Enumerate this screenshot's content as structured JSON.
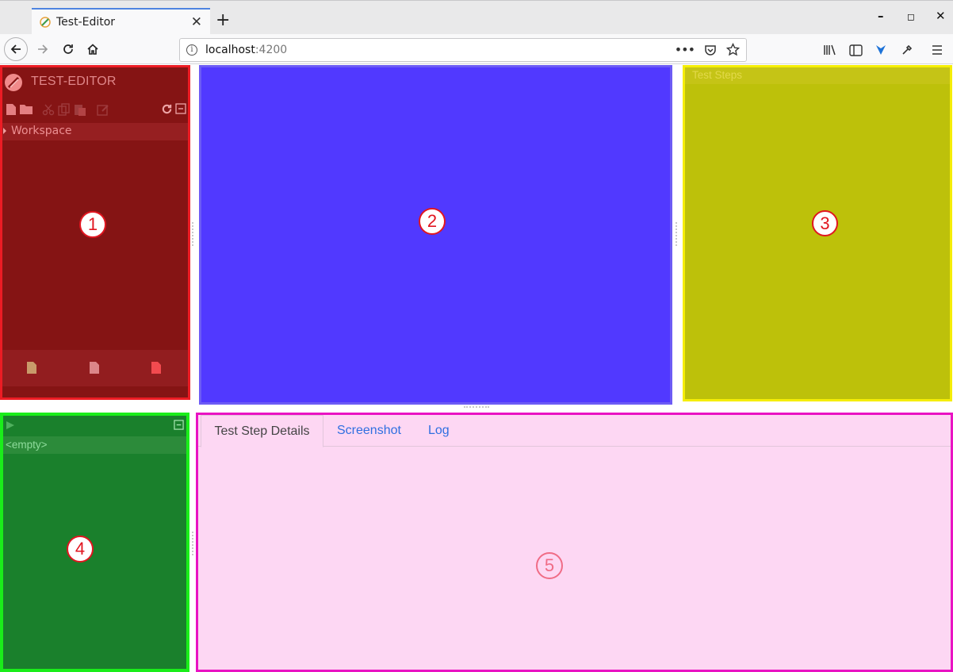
{
  "browser": {
    "tab_title": "Test-Editor",
    "url_host": "localhost",
    "url_port": ":4200"
  },
  "panels": {
    "navigation": {
      "title": "TEST-EDITOR",
      "tree_root": "Workspace",
      "badge": "1"
    },
    "editor": {
      "badge": "2"
    },
    "test_steps": {
      "header": "Test Steps",
      "badge": "3"
    },
    "execution": {
      "empty_label": "<empty>",
      "badge": "4"
    },
    "details": {
      "tabs": [
        "Test Step Details",
        "Screenshot",
        "Log"
      ],
      "badge": "5"
    }
  },
  "colors": {
    "navigation_border": "#ec1c24",
    "editor_border": "#6d5cf5",
    "test_steps_border": "#f5ee06",
    "execution_border": "#1aed1a",
    "details_border": "#e913c3"
  }
}
